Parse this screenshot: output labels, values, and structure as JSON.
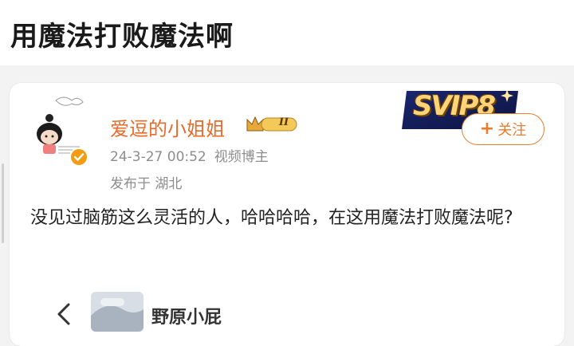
{
  "page": {
    "title": "用魔法打败魔法啊"
  },
  "post": {
    "username": "爱逗的小姐姐",
    "vip_level": "II",
    "timestamp": "24-3-27 00:52",
    "role": "视频博主",
    "location": "发布于 湖北",
    "follow_label": "关注",
    "svip_badge": "SVIP8",
    "text": "没见过脑筋这么灵活的人，哈哈哈哈，在这用魔法打败魔法呢?"
  },
  "repost": {
    "name": "野原小屁"
  },
  "colors": {
    "username": "#e86b2a",
    "follow": "#e67e2e",
    "meta": "#8d8d8d",
    "verified": "#f39c12"
  },
  "icons": {
    "avatar": "cartoon-girl-avatar",
    "verified": "verified-badge-icon",
    "vip": "crown-vip-icon",
    "back": "chevron-left-icon"
  }
}
